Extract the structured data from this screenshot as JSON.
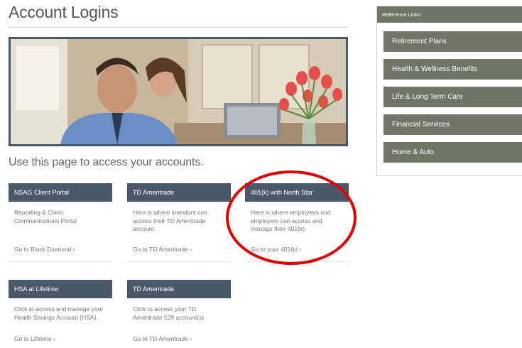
{
  "page": {
    "title": "Account Logins",
    "intro": "Use this page to access your accounts."
  },
  "cards": [
    {
      "header": "NSAG Client Portal",
      "description": "Reporting & Client Communications Portal",
      "link": "Go to Black Diamond ›"
    },
    {
      "header": "TD Ameritrade",
      "description": "Here is where investors can access their TD Ameritrade account.",
      "link": "Go to TD Ameritrade ›"
    },
    {
      "header": "401(k) with North Star",
      "description": "Here is where employees and employers can access and manage their 401(k).",
      "link": "Go to your 401(k) ›"
    },
    {
      "header": "HSA at Lifetime",
      "description": "Click to access and manage your Health Savings Account (HSA).",
      "link": "Go to Lifetime ›"
    },
    {
      "header": "TD Ameritrade",
      "description": "Click to access your TD Ameritrade 529 account(s)",
      "link": "Go to TD Ameritrade ›"
    }
  ],
  "reference": {
    "header": "Reference Links",
    "items": [
      "Retirement Plans",
      "Health & Wellness Benefits",
      "Life & Long Term Care",
      "Financial Services",
      "Home & Auto"
    ]
  },
  "colors": {
    "card_header": "#4a586a",
    "reference_button": "#6f7668",
    "annotation_ring": "#e00000"
  }
}
